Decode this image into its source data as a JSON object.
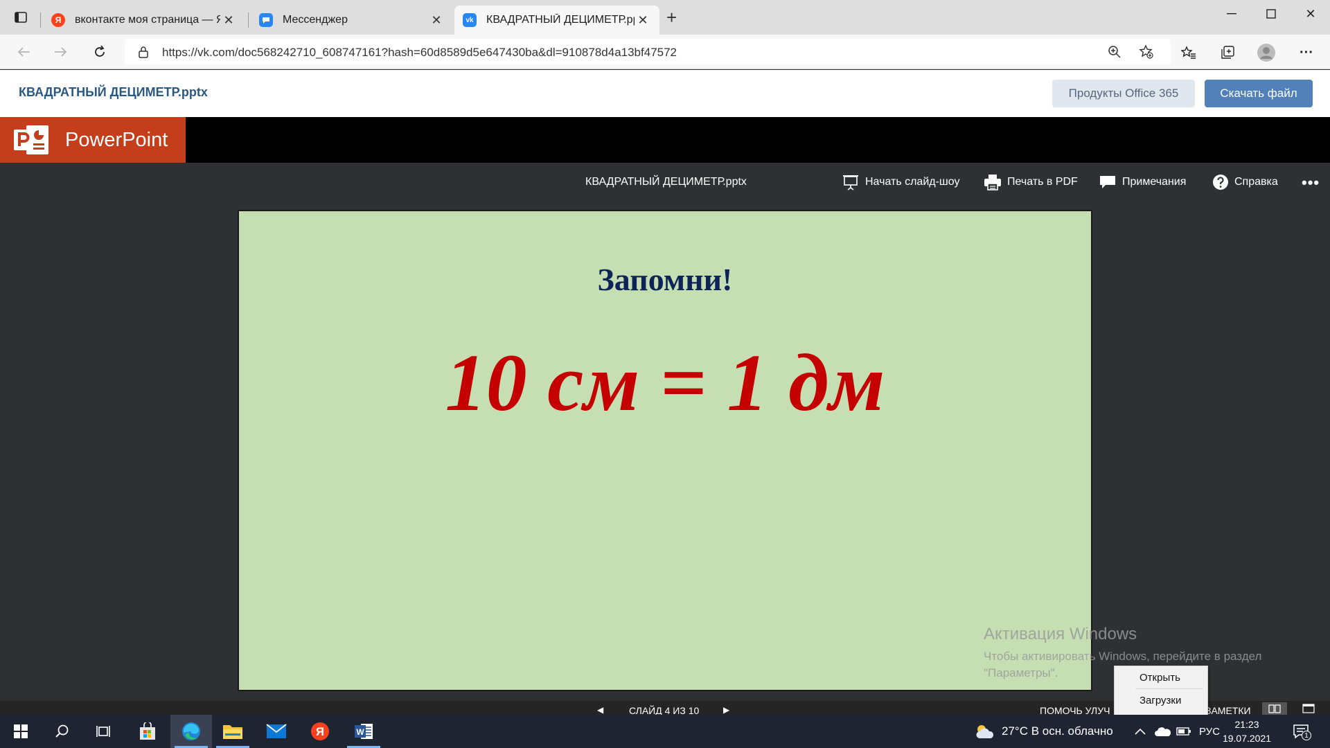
{
  "browser": {
    "tabs": [
      {
        "title": "вконтакте моя страница — Янд",
        "icon": "yandex-icon",
        "active": false
      },
      {
        "title": "Мессенджер",
        "icon": "messenger-icon",
        "active": false
      },
      {
        "title": "КВАДРАТНЫЙ ДЕЦИМЕТР.pptx",
        "icon": "vk-icon",
        "active": true
      }
    ],
    "url": "https://vk.com/doc568242710_608747161?hash=60d8589d5e647430ba&dl=910878d4a13bf47572"
  },
  "vk": {
    "doc_title": "КВАДРАТНЫЙ ДЕЦИМЕТР.pptx",
    "office_button": "Продукты Office 365",
    "download_button": "Скачать файл"
  },
  "powerpoint": {
    "app_name": "PowerPoint",
    "file_name": "КВАДРАТНЫЙ ДЕЦИМЕТР.pptx",
    "toolbar": {
      "slideshow": "Начать слайд-шоу",
      "print_pdf": "Печать в PDF",
      "notes": "Примечания",
      "help": "Справка",
      "more": "•••"
    },
    "slide": {
      "title": "Запомни!",
      "equation": "10 см = 1 дм"
    },
    "status": {
      "slide_counter": "СЛАЙД 4 ИЗ 10",
      "help_improve": "ПОМОЧЬ УЛУЧ",
      "notes": "ЗАМЕТКИ"
    }
  },
  "watermark": {
    "title": "Активация Windows",
    "line1": "Чтобы активировать Windows, перейдите в раздел",
    "line2": "\"Параметры\"."
  },
  "context_menu": {
    "items": [
      "Открыть",
      "Загрузки"
    ]
  },
  "taskbar": {
    "weather": "27°C  В осн. облачно",
    "language": "РУС",
    "time": "21:23",
    "date": "19.07.2021",
    "notification_count": "1"
  },
  "colors": {
    "vk_blue": "#5181b8",
    "powerpoint_orange": "#c43e1c",
    "slide_background": "#c5dfb3",
    "slide_title": "#0e2358",
    "slide_equation": "#c40000"
  }
}
